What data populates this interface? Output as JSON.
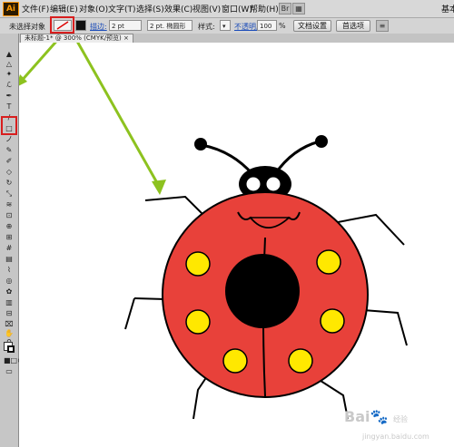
{
  "app": {
    "logo_text": "Ai"
  },
  "menubar": {
    "items": [
      "文件(F)",
      "编辑(E)",
      "对象(O)",
      "文字(T)",
      "选择(S)",
      "效果(C)",
      "视图(V)",
      "窗口(W)",
      "帮助(H)"
    ],
    "right_label": "基本"
  },
  "control_bar": {
    "selection_status": "未选择对象",
    "stroke_label": "描边:",
    "stroke_value": "2 pt",
    "brush_value": "2 pt. 椭圆形",
    "style_label": "样式:",
    "opacity_label": "不透明度:",
    "opacity_value": "100",
    "opacity_unit": "%",
    "doc_settings_button": "文档设置",
    "preferences_button": "首选项"
  },
  "document_tab": {
    "label": "未标题-1* @ 300% (CMYK/预览)",
    "close_glyph": "×"
  },
  "tools": [
    {
      "name": "selection-tool-icon",
      "glyph": "▲"
    },
    {
      "name": "direct-selection-tool-icon",
      "glyph": "△"
    },
    {
      "name": "magic-wand-tool-icon",
      "glyph": "✦"
    },
    {
      "name": "lasso-tool-icon",
      "glyph": "ℒ"
    },
    {
      "name": "pen-tool-icon",
      "glyph": "✒"
    },
    {
      "name": "type-tool-icon",
      "glyph": "T"
    },
    {
      "name": "line-tool-icon",
      "glyph": "/"
    },
    {
      "name": "rectangle-tool-icon",
      "glyph": "□"
    },
    {
      "name": "paintbrush-tool-icon",
      "glyph": "ノ"
    },
    {
      "name": "pencil-tool-icon",
      "glyph": "✎"
    },
    {
      "name": "blob-brush-tool-icon",
      "glyph": "✐"
    },
    {
      "name": "eraser-tool-icon",
      "glyph": "◇"
    },
    {
      "name": "rotate-tool-icon",
      "glyph": "↻"
    },
    {
      "name": "scale-tool-icon",
      "glyph": "⤡"
    },
    {
      "name": "width-tool-icon",
      "glyph": "≋"
    },
    {
      "name": "free-transform-tool-icon",
      "glyph": "⊡"
    },
    {
      "name": "shape-builder-tool-icon",
      "glyph": "⊕"
    },
    {
      "name": "perspective-grid-tool-icon",
      "glyph": "⊞"
    },
    {
      "name": "mesh-tool-icon",
      "glyph": "#"
    },
    {
      "name": "gradient-tool-icon",
      "glyph": "▤"
    },
    {
      "name": "eyedropper-tool-icon",
      "glyph": "⌇"
    },
    {
      "name": "blend-tool-icon",
      "glyph": "◎"
    },
    {
      "name": "symbol-sprayer-tool-icon",
      "glyph": "✿"
    },
    {
      "name": "column-graph-tool-icon",
      "glyph": "▥"
    },
    {
      "name": "artboard-tool-icon",
      "glyph": "⊟"
    },
    {
      "name": "slice-tool-icon",
      "glyph": "⌧"
    },
    {
      "name": "hand-tool-icon",
      "glyph": "✋"
    },
    {
      "name": "zoom-tool-icon",
      "glyph": "⚲"
    }
  ],
  "colors": {
    "ladybug_body": "#e8413a",
    "spots": "#ffe800",
    "eye_white": "#ffffff",
    "outline": "#000000",
    "arrow": "#8dc21f",
    "highlight": "#d81e1e",
    "ai_orange": "#ff9a00"
  },
  "watermark": {
    "text": "Bai",
    "suffix": "经验",
    "sub": "jingyan.baidu.com"
  }
}
